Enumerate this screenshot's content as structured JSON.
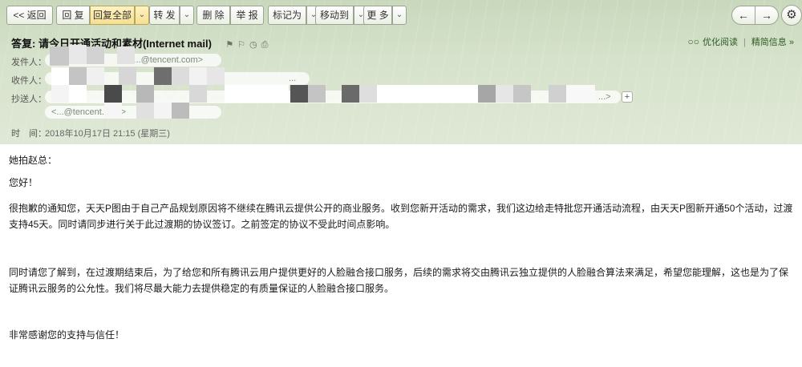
{
  "toolbar": {
    "back": "<< 返回",
    "reply": "回 复",
    "reply_all": "回复全部",
    "forward": "转 发",
    "delete": "删 除",
    "report": "举 报",
    "mark_as": "标记为",
    "move_to": "移动到",
    "more": "更 多",
    "prev": "←",
    "next": "→",
    "settings": "⚙"
  },
  "header": {
    "subject": "答复: 请今日开通活动和素材(Internet mail)",
    "subject_icons": "⚑⚐◷⎙",
    "optimize_reading": "优化阅读",
    "brief_info": "精简信息 »",
    "from_label": "发件人：",
    "from_value": "<...@tencent.com>",
    "to_label": "收件人：",
    "to_value": "...",
    "cc_label": "抄送人：",
    "cc_value": "<...@tencent.com>",
    "cc_more": "...>",
    "cc_plus": "+",
    "time_label": "时　间：",
    "time_value": "2018年10月17日 21:15 (星期三)"
  },
  "body": {
    "greeting": "她拍赵总：",
    "hello": "您好！",
    "para1": "很抱歉的通知您，天天P图由于自己产品规划原因将不继续在腾讯云提供公开的商业服务。收到您新开活动的需求，我们这边给走特批您开通活动流程，由天天P图新开通50个活动，过渡支持45天。同时请同步进行关于此过渡期的协议签订。之前签定的协议不受此时间点影响。",
    "para2": "同时请您了解到，在过渡期结束后，为了给您和所有腾讯云用户提供更好的人脸融合接口服务，后续的需求将交由腾讯云独立提供的人脸融合算法来满足，希望您能理解，这也是为了保证腾讯云服务的公允性。我们将尽最大能力去提供稳定的有质量保证的人脸融合接口服务。",
    "closing": "非常感谢您的支持与信任！"
  },
  "colors": {
    "header_bg": "#d6e2cb",
    "highlight_button": "#f5df92",
    "link_green": "#2b5c25"
  }
}
